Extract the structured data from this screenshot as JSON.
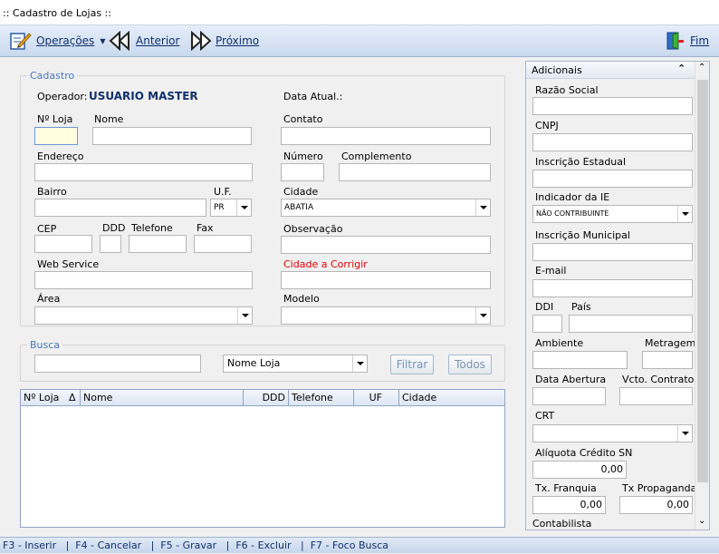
{
  "window": {
    "title": ":: Cadastro de Lojas ::"
  },
  "toolbar": {
    "operacoes": "Operações",
    "anterior": "Anterior",
    "proximo": "Próximo",
    "fim": "Fim"
  },
  "cadastro": {
    "legend": "Cadastro",
    "operador_label": "Operador:",
    "operador_value": "USUARIO MASTER",
    "data_atual_label": "Data Atual.:",
    "nloja_label": "Nº Loja",
    "nloja_value": "",
    "nome_label": "Nome",
    "nome_value": "",
    "contato_label": "Contato",
    "contato_value": "",
    "endereco_label": "Endereço",
    "endereco_value": "",
    "numero_label": "Número",
    "numero_value": "",
    "complemento_label": "Complemento",
    "complemento_value": "",
    "bairro_label": "Bairro",
    "bairro_value": "",
    "uf_label": "U.F.",
    "uf_value": "PR",
    "cidade_label": "Cidade",
    "cidade_value": "ABATIA",
    "cep_label": "CEP",
    "ddd_label": "DDD",
    "telefone_label": "Telefone",
    "fax_label": "Fax",
    "observacao_label": "Observação",
    "webservice_label": "Web Service",
    "cidade_corrigir_label": "Cidade a Corrigir",
    "area_label": "Área",
    "area_value": "",
    "modelo_label": "Modelo",
    "modelo_value": ""
  },
  "busca": {
    "legend": "Busca",
    "input_value": "",
    "campo_value": "Nome Loja",
    "filtrar": "Filtrar",
    "todos": "Todos"
  },
  "grid": {
    "columns": [
      "Nº Loja",
      "Nome",
      "DDD",
      "Telefone",
      "UF",
      "Cidade"
    ],
    "sort_indicator": "Δ",
    "rows": []
  },
  "adicionais": {
    "header": "Adicionais",
    "razao_social": "Razão Social",
    "cnpj": "CNPJ",
    "inscricao_estadual": "Inscrição Estadual",
    "indicador_ie": "Indicador da IE",
    "indicador_ie_value": "NÃO CONTRIBUINTE",
    "inscricao_municipal": "Inscrição Municipal",
    "email": "E-mail",
    "ddi": "DDI",
    "pais": "País",
    "ambiente": "Ambiente",
    "metragem": "Metragem",
    "data_abertura": "Data Abertura",
    "vcto_contrato": "Vcto. Contrato",
    "crt": "CRT",
    "crt_value": "",
    "aliquota_credito": "Alíquota Crédito SN",
    "aliquota_value": "0,00",
    "tx_franquia": "Tx. Franquia",
    "tx_franquia_value": "0,00",
    "tx_propaganda": "Tx Propaganda",
    "tx_propaganda_value": "0,00",
    "contabilista": "Contabilista"
  },
  "statusbar": {
    "text": "F3 - Inserir   |  F4 - Cancelar   |  F5 - Gravar   |  F6 - Excluir   |  F7 - Foco Busca"
  },
  "colors": {
    "accent": "#4a76b8",
    "title_blue": "#10306b",
    "warning_red": "#e00000"
  },
  "icons": [
    "operations-icon",
    "previous-icon",
    "next-icon",
    "exit-icon",
    "collapse-icon",
    "scroll-up-icon",
    "scroll-down-icon"
  ]
}
